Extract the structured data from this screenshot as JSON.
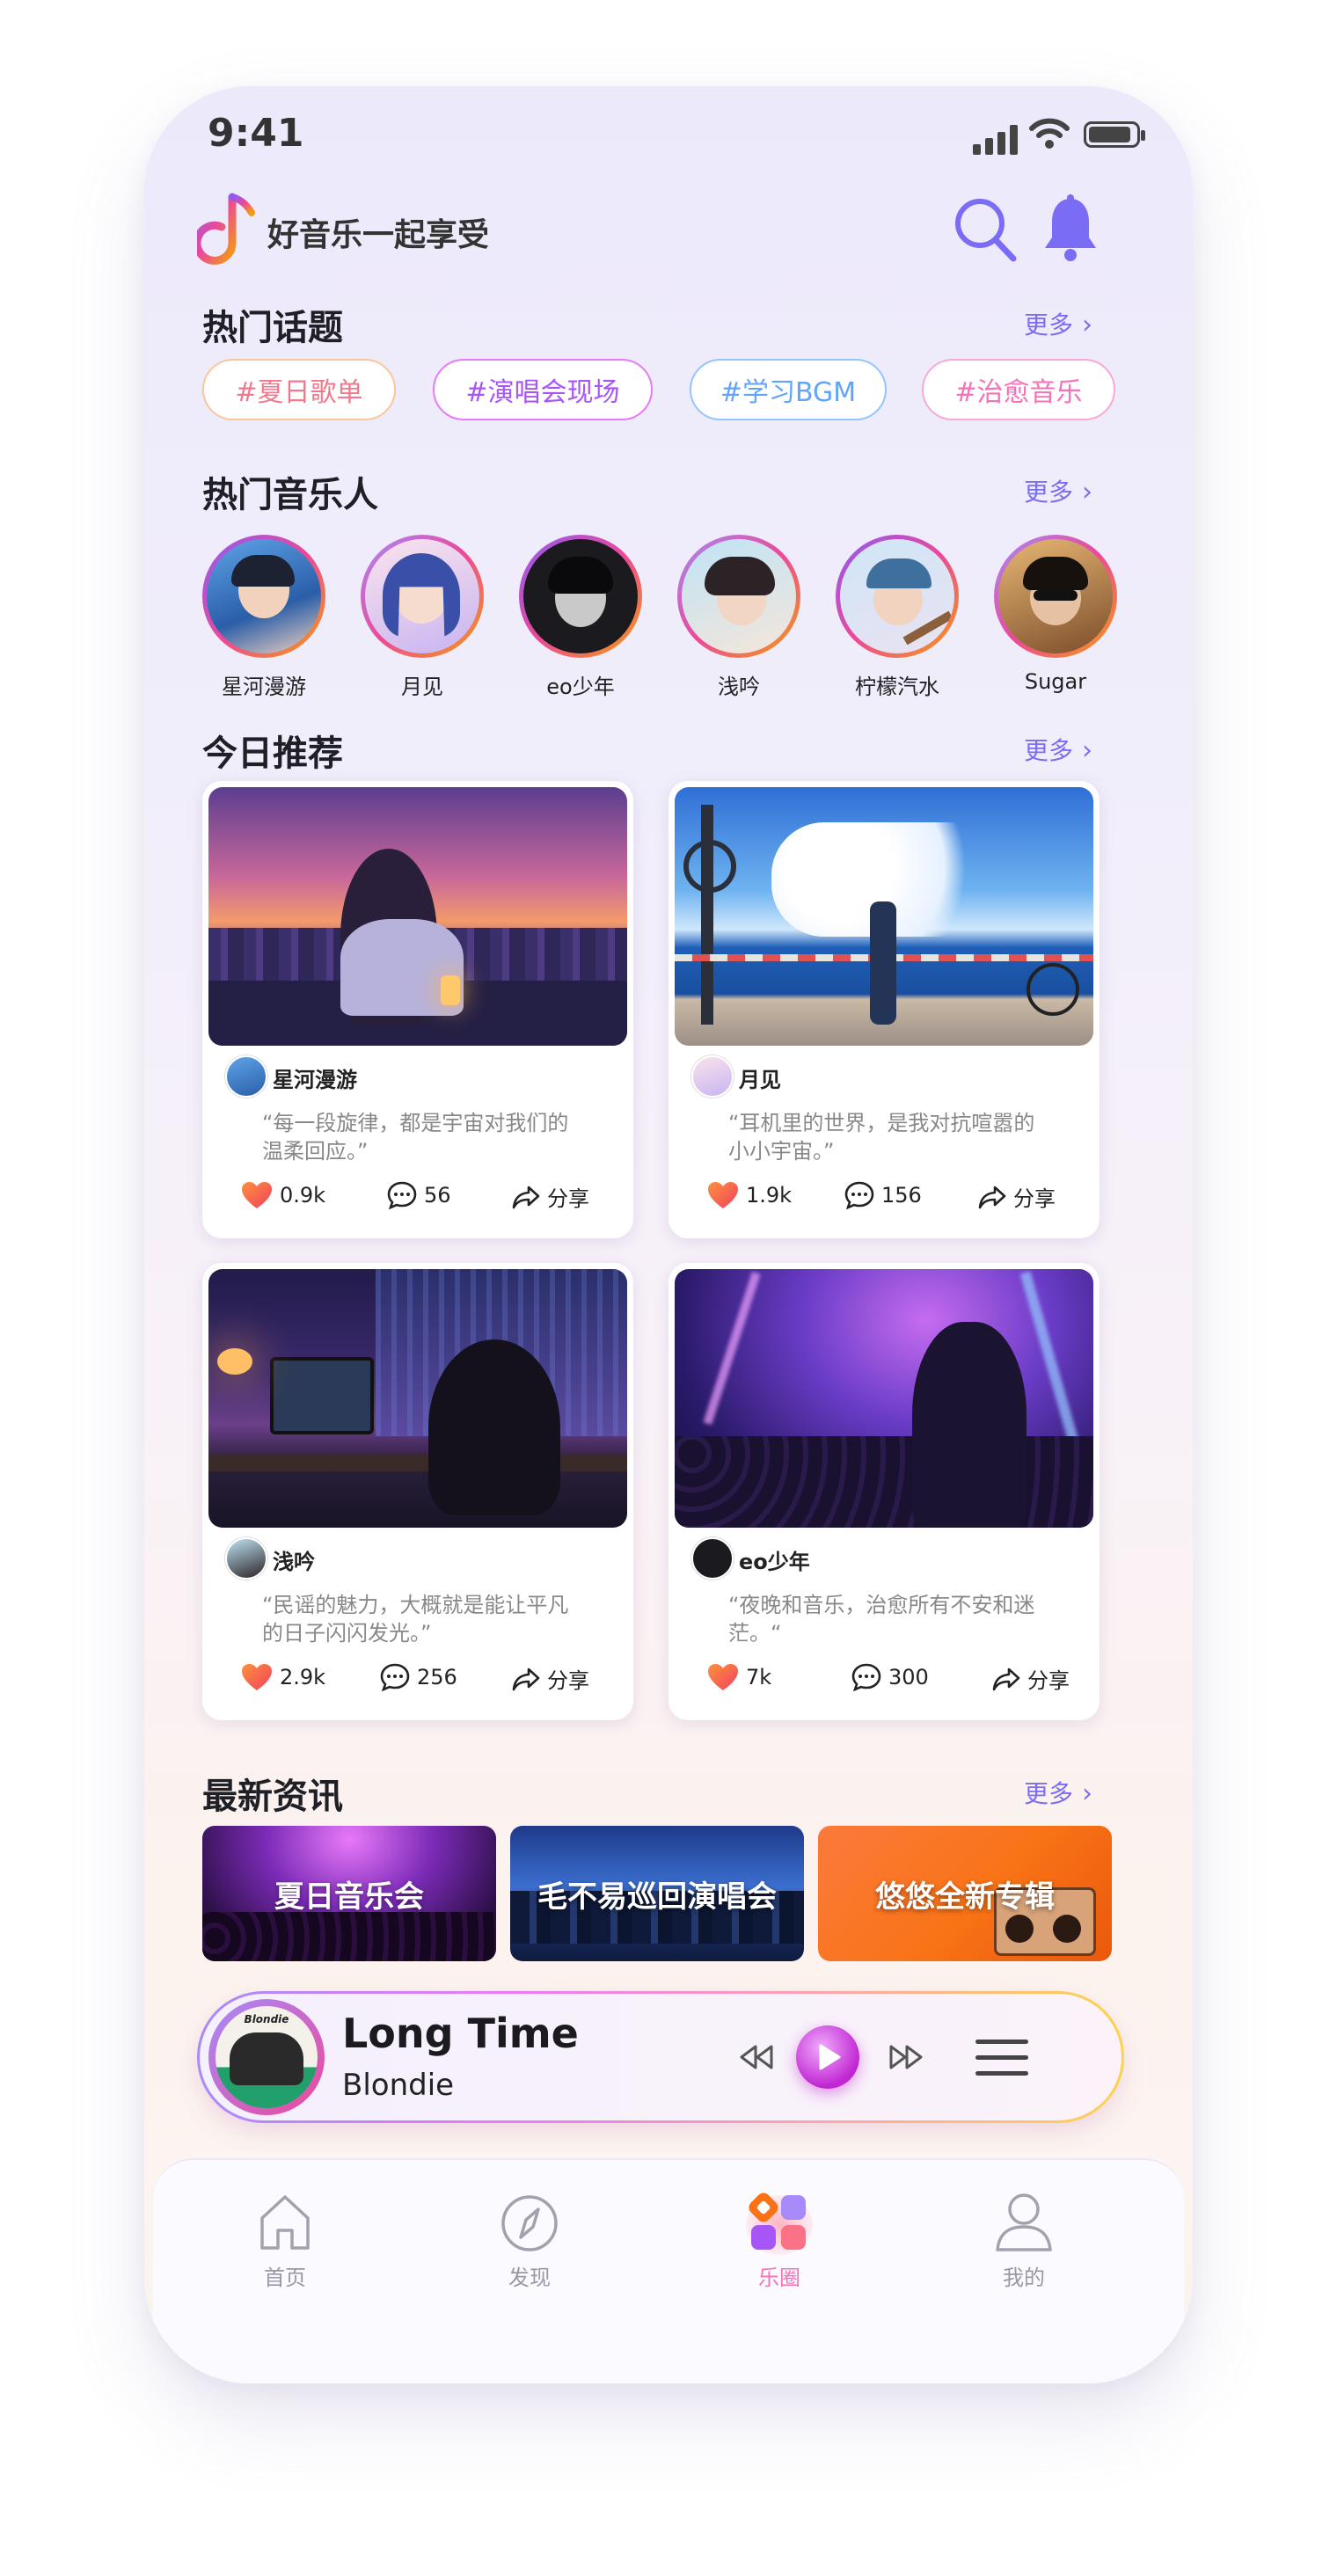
{
  "status": {
    "time": "9:41"
  },
  "app": {
    "title": "好音乐一起享受"
  },
  "topics": {
    "title": "热门话题",
    "more": "更多",
    "tags": [
      "#夏日歌单",
      "#演唱会现场",
      "#学习BGM",
      "#治愈音乐"
    ]
  },
  "artists": {
    "title": "热门音乐人",
    "more": "更多",
    "items": [
      "星河漫游",
      "月见",
      "eo少年",
      "浅吟",
      "柠檬汽水",
      "Sugar"
    ]
  },
  "today": {
    "title": "今日推荐",
    "more": "更多",
    "cards": [
      {
        "user": "星河漫游",
        "quote": "“每一段旋律，都是宇宙对我们的温柔回应。”",
        "likes": "0.9k",
        "comments": "56",
        "share": "分享"
      },
      {
        "user": "月见",
        "quote": "“耳机里的世界，是我对抗喧嚣的小小宇宙。”",
        "likes": "1.9k",
        "comments": "156",
        "share": "分享"
      },
      {
        "user": "浅吟",
        "quote": "“民谣的魅力，大概就是能让平凡的日子闪闪发光。”",
        "likes": "2.9k",
        "comments": "256",
        "share": "分享"
      },
      {
        "user": "eo少年",
        "quote": "“夜晚和音乐，治愈所有不安和迷茫。“",
        "likes": "7k",
        "comments": "300",
        "share": "分享"
      }
    ]
  },
  "news": {
    "title": "最新资讯",
    "more": "更多",
    "items": [
      "夏日音乐会",
      "毛不易巡回演唱会",
      "悠悠全新专辑"
    ]
  },
  "player": {
    "album_text": "Blondie",
    "song": "Long Time",
    "artist": "Blondie"
  },
  "tabs": [
    "首页",
    "发现",
    "乐圈",
    "我的"
  ],
  "colors": {
    "accent": "#7b6cf5",
    "active_tab": "#f472b6",
    "like": "#f43f5e"
  }
}
